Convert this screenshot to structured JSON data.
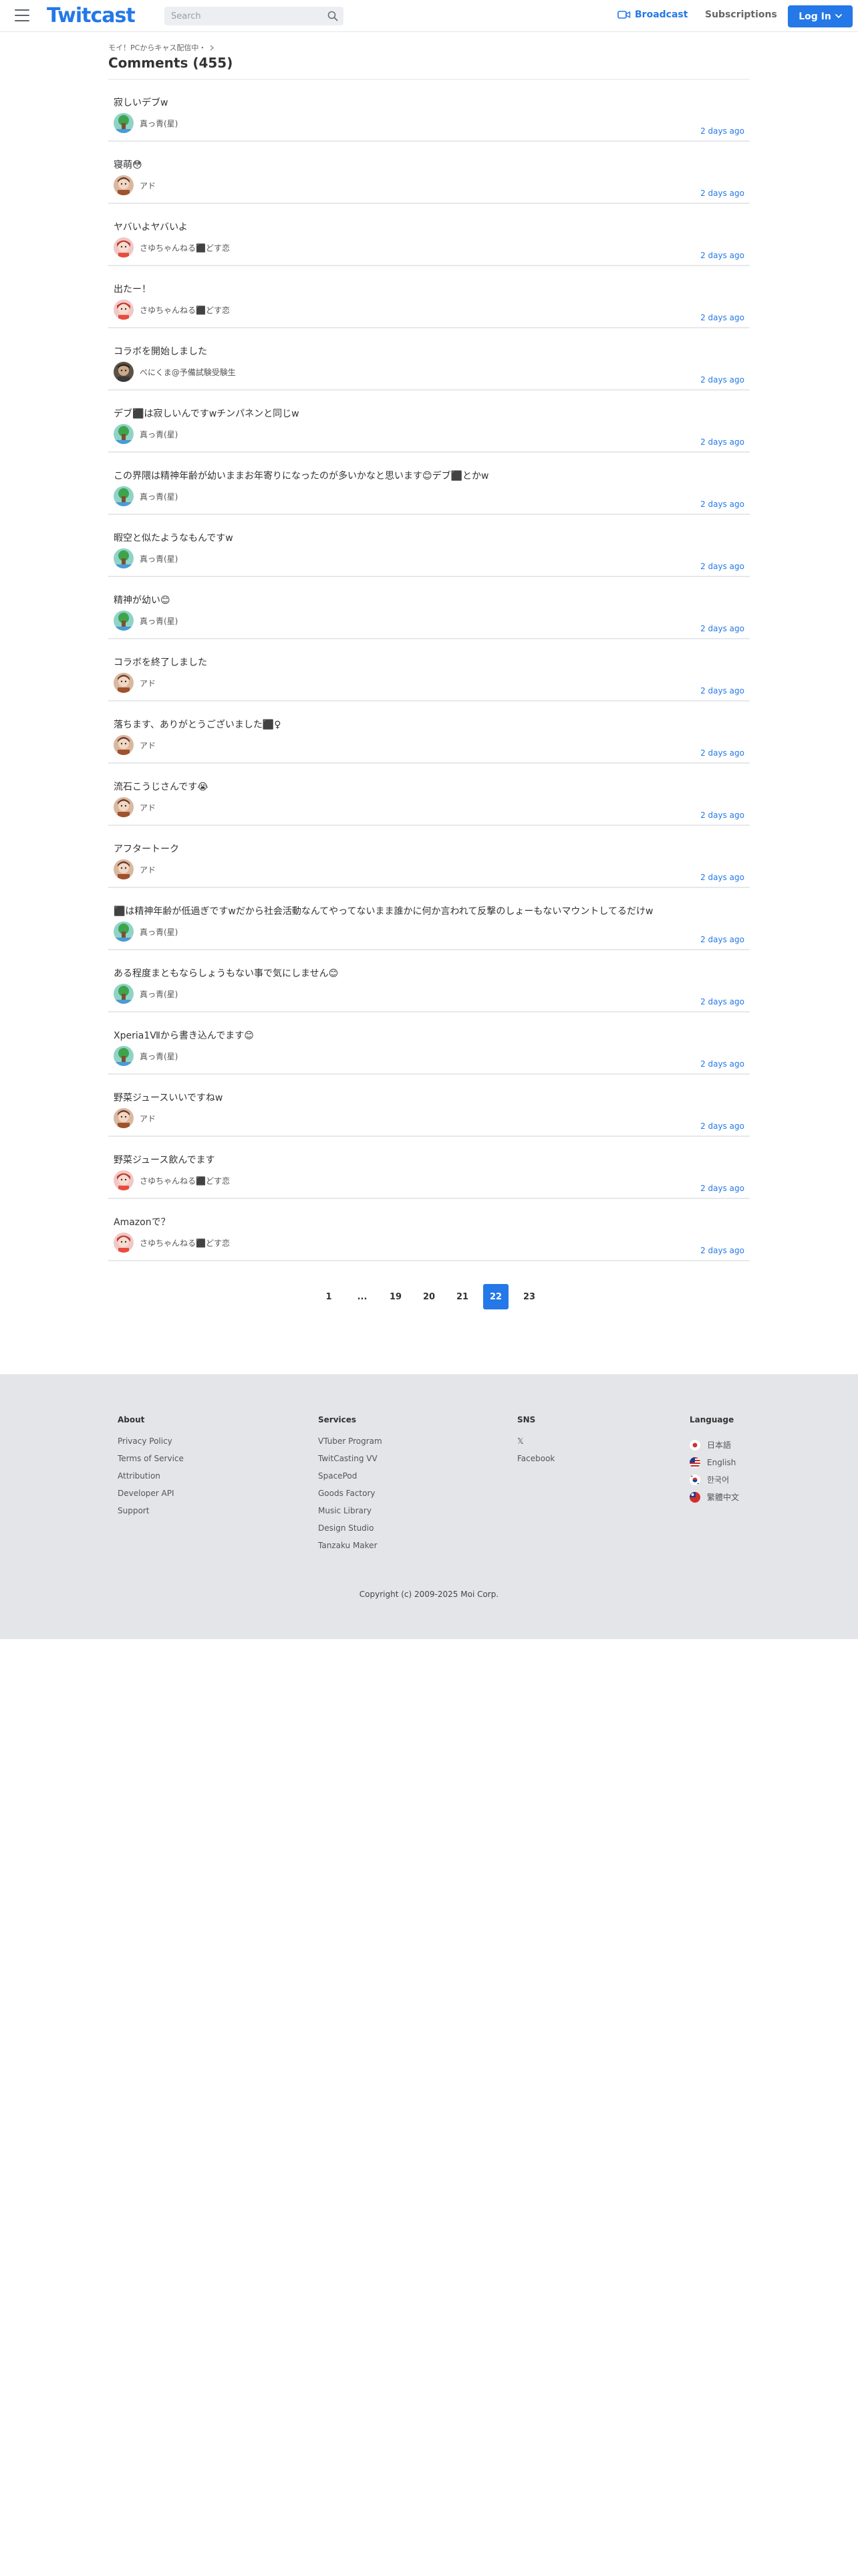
{
  "header": {
    "logo": "Twitcast",
    "search_placeholder": "Search",
    "broadcast_label": "Broadcast",
    "subscriptions_label": "Subscriptions",
    "login_label": "Log In"
  },
  "breadcrumb": {
    "text": "モイ！PCからキャス配信中・"
  },
  "page_title": "Comments (455)",
  "comments": [
    {
      "text": "寂しいデブw",
      "user": "真っ青(星)",
      "time": "2 days ago",
      "avatar": "green"
    },
    {
      "text": "寝萌😳",
      "user": "アド",
      "time": "2 days ago",
      "avatar": "brown"
    },
    {
      "text": "ヤバいよヤバいよ",
      "user": "さゆちゃんねる⬛どす恋",
      "time": "2 days ago",
      "avatar": "red"
    },
    {
      "text": "出たー！",
      "user": "さゆちゃんねる⬛どす恋",
      "time": "2 days ago",
      "avatar": "red"
    },
    {
      "text": "コラボを開始しました",
      "user": "べにくま@予備試験受験生",
      "time": "2 days ago",
      "avatar": "dark"
    },
    {
      "text": "デブ⬛は寂しいんですwチンパネンと同じw",
      "user": "真っ青(星)",
      "time": "2 days ago",
      "avatar": "green"
    },
    {
      "text": "この界隈は精神年齢が幼いままお年寄りになったのが多いかなと思います😊デブ⬛とかw",
      "user": "真っ青(星)",
      "time": "2 days ago",
      "avatar": "green"
    },
    {
      "text": "暇空と似たようなもんですw",
      "user": "真っ青(星)",
      "time": "2 days ago",
      "avatar": "green"
    },
    {
      "text": "精神が幼い😊",
      "user": "真っ青(星)",
      "time": "2 days ago",
      "avatar": "green"
    },
    {
      "text": "コラボを終了しました",
      "user": "アド",
      "time": "2 days ago",
      "avatar": "brown"
    },
    {
      "text": "落ちます、ありがとうございました⬛♀",
      "user": "アド",
      "time": "2 days ago",
      "avatar": "brown"
    },
    {
      "text": "流石こうじさんです😭",
      "user": "アド",
      "time": "2 days ago",
      "avatar": "brown"
    },
    {
      "text": "アフタートーク",
      "user": "アド",
      "time": "2 days ago",
      "avatar": "brown"
    },
    {
      "text": "⬛は精神年齢が低過ぎですwだから社会活動なんてやってないまま誰かに何か言われて反撃のしょーもないマウントしてるだけw",
      "user": "真っ青(星)",
      "time": "2 days ago",
      "avatar": "green"
    },
    {
      "text": "ある程度まともならしょうもない事で気にしません😊",
      "user": "真っ青(星)",
      "time": "2 days ago",
      "avatar": "green"
    },
    {
      "text": "Xperia1Ⅶから書き込んでます😊",
      "user": "真っ青(星)",
      "time": "2 days ago",
      "avatar": "green"
    },
    {
      "text": "野菜ジュースいいですねw",
      "user": "アド",
      "time": "2 days ago",
      "avatar": "brown"
    },
    {
      "text": "野菜ジュース飲んでます",
      "user": "さゆちゃんねる⬛どす恋",
      "time": "2 days ago",
      "avatar": "red"
    },
    {
      "text": "Amazonで？",
      "user": "さゆちゃんねる⬛どす恋",
      "time": "2 days ago",
      "avatar": "red"
    }
  ],
  "pagination": {
    "pages": [
      "1",
      "...",
      "19",
      "20",
      "21",
      "22",
      "23"
    ],
    "current": "22"
  },
  "footer": {
    "about": {
      "heading": "About",
      "links": [
        "Privacy Policy",
        "Terms of Service",
        "Attribution",
        "Developer API",
        "Support"
      ]
    },
    "services": {
      "heading": "Services",
      "links": [
        "VTuber Program",
        "TwitCasting VV",
        "SpacePod",
        "Goods Factory",
        "Music Library",
        "Design Studio",
        "Tanzaku Maker"
      ]
    },
    "sns": {
      "heading": "SNS",
      "links": [
        "𝕏",
        "Facebook"
      ]
    },
    "language": {
      "heading": "Language",
      "items": [
        {
          "label": "日本語",
          "flag": "jp-flag-icon"
        },
        {
          "label": "English",
          "flag": "us-flag-icon"
        },
        {
          "label": "한국어",
          "flag": "kr-flag-icon"
        },
        {
          "label": "繁體中文",
          "flag": "tw-flag-icon"
        }
      ]
    },
    "copyright": "Copyright (c) 2009-2025 Moi Corp."
  },
  "colors": {
    "accent": "#2478e8",
    "footer_bg": "#e3e5e8",
    "divider": "#e6e8eb"
  }
}
